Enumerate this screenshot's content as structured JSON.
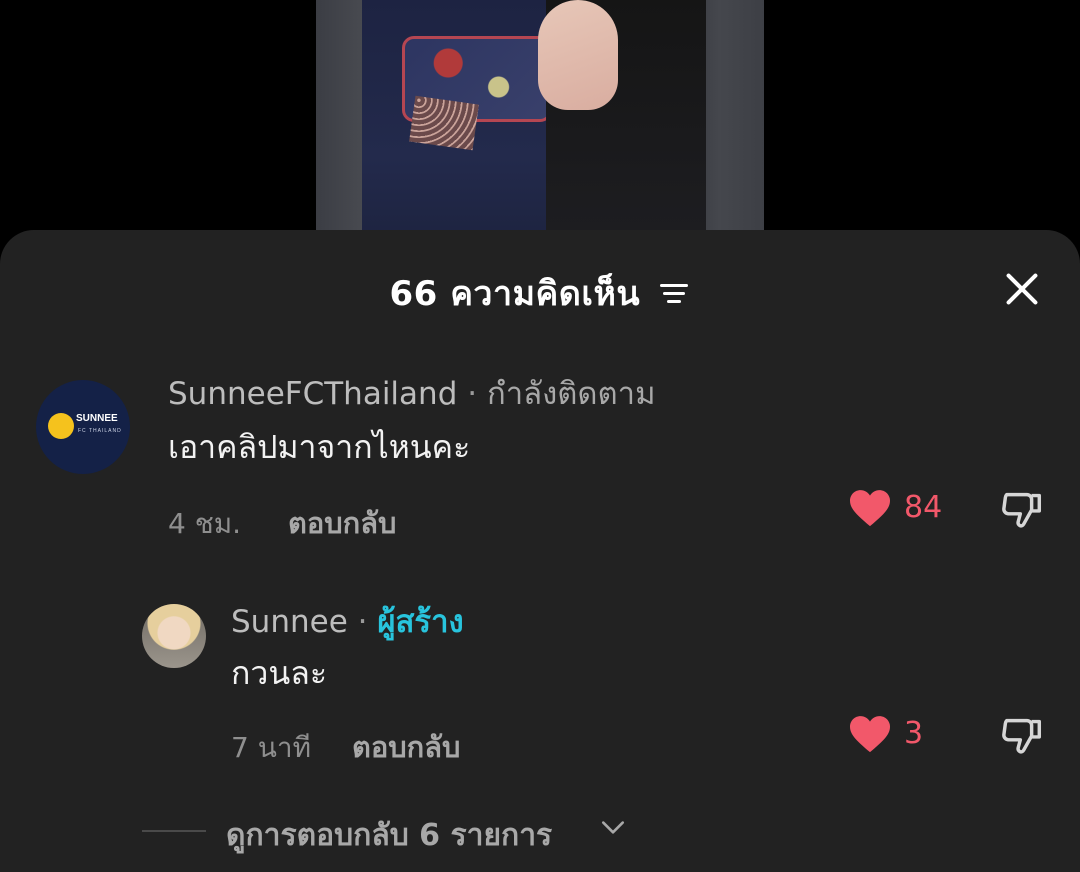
{
  "sheet": {
    "count": "66",
    "title": "ความคิดเห็น"
  },
  "comments": [
    {
      "username": "SunneeFCThailand",
      "separator": "·",
      "tag": "กำลังติดตาม",
      "text": "เอาคลิปมาจากไหนคะ",
      "time": "4 ชม.",
      "reply_label": "ตอบกลับ",
      "likes": "84",
      "avatar_label": "SUNNEE",
      "avatar_sub": "FC THAILAND"
    },
    {
      "username": "Sunnee",
      "separator": "·",
      "tag": "ผู้สร้าง",
      "text": "กวนละ",
      "time": "7 นาที",
      "reply_label": "ตอบกลับ",
      "likes": "3"
    }
  ],
  "view_replies": "ดูการตอบกลับ 6 รายการ",
  "colors": {
    "sheet_bg": "#222222",
    "like_red": "#f2586a",
    "creator_tag": "#28c4dd"
  },
  "icons": {
    "filter": "filter-icon",
    "close": "close-icon",
    "like": "heart-icon",
    "dislike": "thumbs-down-icon",
    "expand": "chevron-down-icon"
  }
}
